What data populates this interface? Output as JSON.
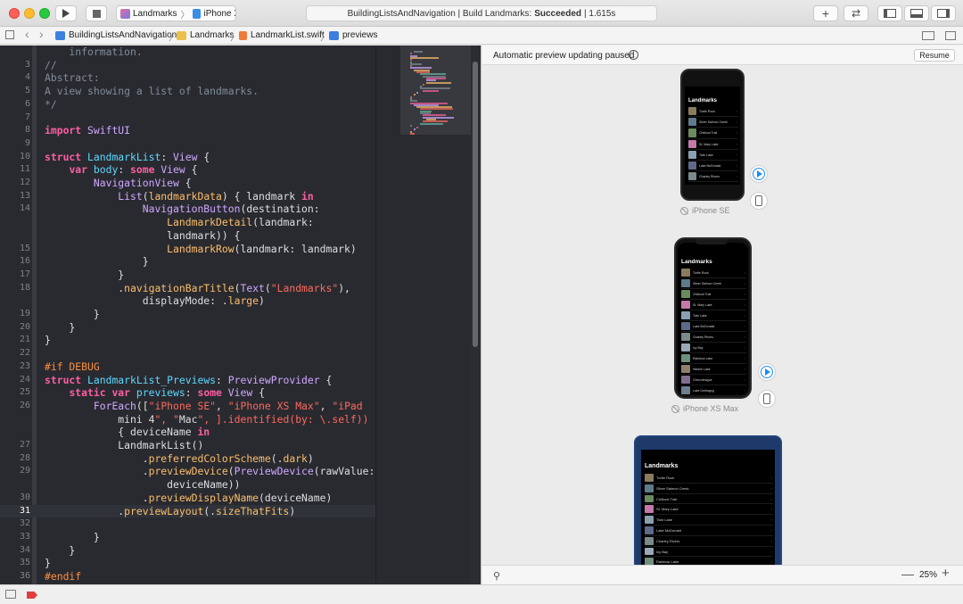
{
  "toolbar": {
    "scheme_app": "Landmarks",
    "scheme_device": "iPhone Xʀ",
    "activity_prefix": "BuildingListsAndNavigation | Build Landmarks:",
    "activity_status": "Succeeded",
    "activity_time": "| 1.615s",
    "add_label": "+",
    "swap_label": "⇄"
  },
  "breadcrumb": {
    "items": [
      "BuildingListsAndNavigation",
      "Landmarks",
      "LandmarkList.swift",
      "previews"
    ],
    "back_label": "‹",
    "forward_label": "›"
  },
  "editor": {
    "current_line": "31",
    "lines": [
      {
        "n": "",
        "t": "    information."
      },
      {
        "n": "3",
        "t": "//"
      },
      {
        "n": "4",
        "t": "Abstract:"
      },
      {
        "n": "5",
        "t": "A view showing a list of landmarks."
      },
      {
        "n": "6",
        "t": "*/"
      },
      {
        "n": "7",
        "t": ""
      },
      {
        "n": "8",
        "t": "import SwiftUI"
      },
      {
        "n": "9",
        "t": ""
      },
      {
        "n": "10",
        "t": "struct LandmarkList: View {"
      },
      {
        "n": "11",
        "t": "    var body: some View {"
      },
      {
        "n": "12",
        "t": "        NavigationView {"
      },
      {
        "n": "13",
        "t": "            List(landmarkData) { landmark in"
      },
      {
        "n": "14",
        "t": "                NavigationButton(destination:"
      },
      {
        "n": "",
        "t": "                    LandmarkDetail(landmark:"
      },
      {
        "n": "",
        "t": "                    landmark)) {"
      },
      {
        "n": "15",
        "t": "                    LandmarkRow(landmark: landmark)"
      },
      {
        "n": "16",
        "t": "                }"
      },
      {
        "n": "17",
        "t": "            }"
      },
      {
        "n": "18",
        "t": "            .navigationBarTitle(Text(\"Landmarks\"),"
      },
      {
        "n": "",
        "t": "                displayMode: .large)"
      },
      {
        "n": "19",
        "t": "        }"
      },
      {
        "n": "20",
        "t": "    }"
      },
      {
        "n": "21",
        "t": "}"
      },
      {
        "n": "22",
        "t": ""
      },
      {
        "n": "23",
        "t": "#if DEBUG"
      },
      {
        "n": "24",
        "t": "struct LandmarkList_Previews: PreviewProvider {"
      },
      {
        "n": "25",
        "t": "    static var previews: some View {"
      },
      {
        "n": "26",
        "t": "        ForEach([\"iPhone SE\", \"iPhone XS Max\", \"iPad"
      },
      {
        "n": "",
        "t": "            mini 4\", \"Mac\", ].identified(by: \\.self))"
      },
      {
        "n": "",
        "t": "            { deviceName in"
      },
      {
        "n": "27",
        "t": "            LandmarkList()"
      },
      {
        "n": "28",
        "t": "                .preferredColorScheme(.dark)"
      },
      {
        "n": "29",
        "t": "                .previewDevice(PreviewDevice(rawValue:"
      },
      {
        "n": "",
        "t": "                    deviceName))"
      },
      {
        "n": "30",
        "t": "                .previewDisplayName(deviceName)"
      },
      {
        "n": "31",
        "t": "            .previewLayout(.sizeThatFits)"
      },
      {
        "n": "32",
        "t": ""
      },
      {
        "n": "33",
        "t": "        }"
      },
      {
        "n": "34",
        "t": "    }"
      },
      {
        "n": "35",
        "t": "}"
      },
      {
        "n": "36",
        "t": "#endif"
      }
    ]
  },
  "canvas": {
    "paused_text": "Automatic preview updating paused",
    "resume_label": "Resume",
    "zoom": "25%",
    "zoom_minus": "—",
    "zoom_plus": "+",
    "screen_title": "Landmarks",
    "devices": [
      {
        "label": "iPhone SE"
      },
      {
        "label": "iPhone XS Max"
      }
    ],
    "rows_se": [
      "Turtle Rock",
      "Silver Salmon Creek",
      "Chilkoot Trail",
      "St. Mary Lake",
      "Twin Lake",
      "Lake McDonald",
      "Charley Rivers"
    ],
    "rows_max": [
      "Turtle Rock",
      "Silver Salmon Creek",
      "Chilkoot Trail",
      "St. Mary Lake",
      "Twin Lake",
      "Lake McDonald",
      "Charley Rivers",
      "Icy Bay",
      "Rainbow Lake",
      "Hidden Lake",
      "Chincoteague",
      "Lake Umbagog"
    ],
    "rows_ipad": [
      "Turtle Rock",
      "Silver Salmon Creek",
      "Chilkoot Trail",
      "St. Mary Lake",
      "Twin Lake",
      "Lake McDonald",
      "Charley Rivers",
      "Icy Bay",
      "Rainbow Lake"
    ]
  },
  "colors": {
    "editor_bg": "#292a30",
    "keyword": "#fc5fa3",
    "accent": "#1e8cf0"
  }
}
